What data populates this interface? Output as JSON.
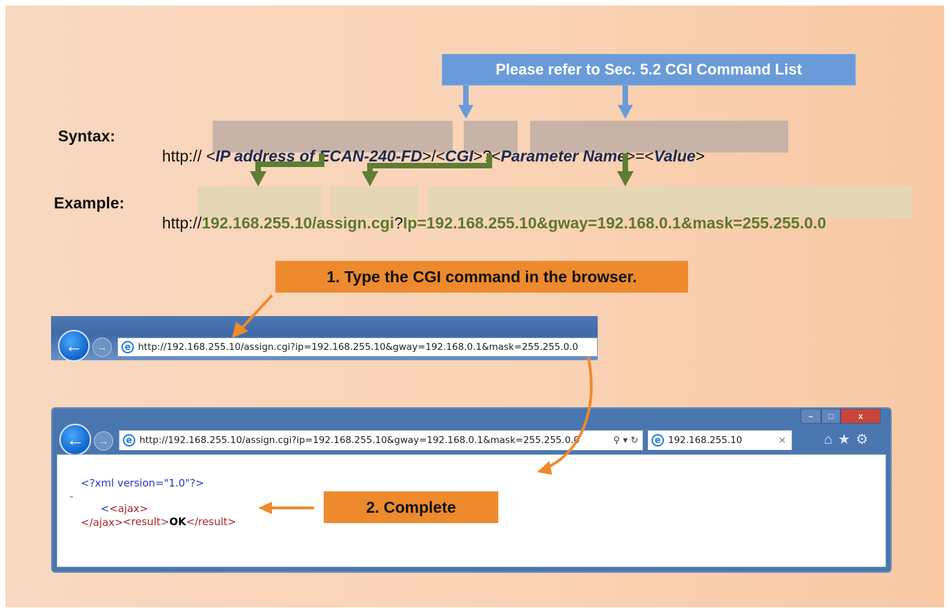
{
  "banner_top": "Please refer to Sec. 5.2 CGI Command List",
  "syntax": {
    "label": "Syntax:",
    "prefix": "http:// <",
    "ip": "IP address of ECAN-240-FD",
    "sep1": ">/<",
    "cgi": "CGI",
    "sep2": ">?<",
    "param": "Parameter Name",
    "sep3": ">=<",
    "value": "Value",
    "suffix": ">"
  },
  "example": {
    "label": "Example:",
    "prefix": "http://",
    "ip": "192.168.255.10",
    "slash": "/",
    "cgi": "assign.cgi",
    "q": "?",
    "params": "Ip=192.168.255.10&gway=192.168.0.1&mask=255.255.0.0"
  },
  "step1": "1. Type the CGI command in the browser.",
  "step2": "2. Complete",
  "browser1": {
    "url": "http://192.168.255.10/assign.cgi?ip=192.168.255.10&gway=192.168.0.1&mask=255.255.0.0"
  },
  "browser2": {
    "url": "http://192.168.255.10/assign.cgi?ip=192.168.255.10&gway=192.168.0.1&mask=255.255.0.0",
    "tab_title": "192.168.255.10",
    "xml_decl": "<?xml version=\"1.0\"?>",
    "collapse": "-",
    "ajax_open": "<ajax>",
    "result_open": "<result>",
    "result_value": "OK",
    "result_close": "</result>",
    "ajax_close": "</ajax>"
  },
  "colors": {
    "blue_banner": "#6a9bd8",
    "orange_banner": "#ee8a2e",
    "blue_arrow": "#6a9bd8",
    "green_arrow": "#5e7d32",
    "orange_arrow": "#ee8a2e"
  }
}
